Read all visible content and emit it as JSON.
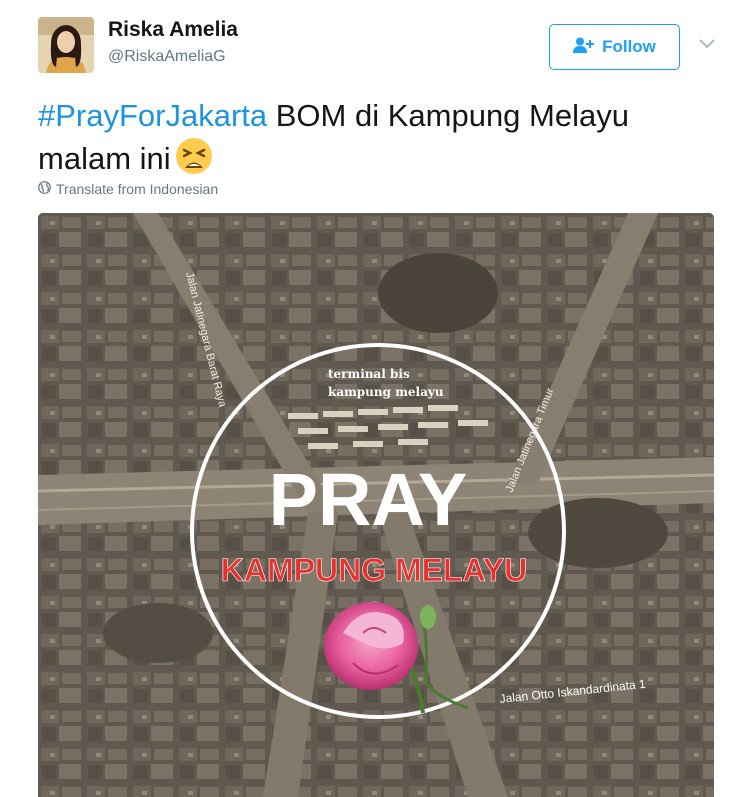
{
  "user": {
    "display_name": "Riska Amelia",
    "handle": "@RiskaAmeliaG"
  },
  "follow_button": {
    "label": "Follow"
  },
  "tweet": {
    "hashtag": "#PrayForJakarta",
    "text_after_hashtag": " BOM di Kampung Melayu malam ini",
    "emoji": "weary-face"
  },
  "translate": {
    "label": "Translate from Indonesian"
  },
  "image": {
    "headline": "PRAY",
    "subheadline": "KAMPUNG MELAYU",
    "label_terminal_line1": "terminal bis",
    "label_terminal_line2": "kampung melayu",
    "road_left": "Jalan Jatinegara Barat Raya",
    "road_right": "Jalan Jatinegara Timur",
    "road_bottom": "Jalan Otto Iskandardinata 1"
  },
  "colors": {
    "accent": "#1da1f2",
    "hashtag": "#1b95e0",
    "subheadline": "#e8312d",
    "sepia": "#6b6357"
  }
}
